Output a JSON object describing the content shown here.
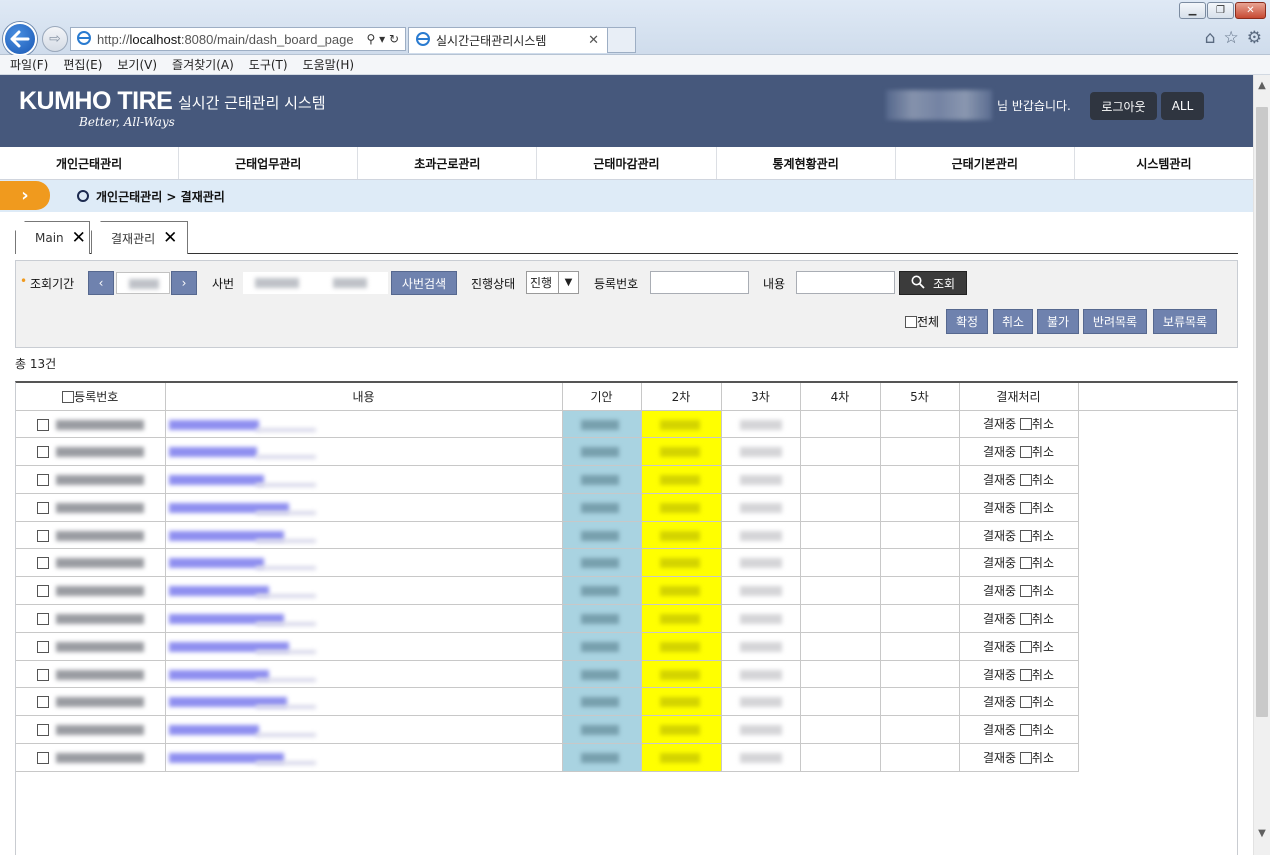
{
  "browser": {
    "url": "http://localhost:8080/main/dash_board_page",
    "url_host": "localhost",
    "url_pre": "http://",
    "url_post": ":8080/main/dash_board_page",
    "tab_title": "실시간근태관리시스템",
    "menu": [
      "파일(F)",
      "편집(E)",
      "보기(V)",
      "즐겨찾기(A)",
      "도구(T)",
      "도움말(H)"
    ]
  },
  "header": {
    "logo": "KUMHO TIRE",
    "tagline": "Better, All-Ways",
    "system_title": "실시간 근태관리 시스템",
    "greeting": "님 반갑습니다.",
    "logout": "로그아웃",
    "all": "ALL"
  },
  "gnb": [
    "개인근태관리",
    "근태업무관리",
    "초과근로관리",
    "근태마감관리",
    "통계현황관리",
    "근태기본관리",
    "시스템관리"
  ],
  "breadcrumb": "개인근태관리 > 결재관리",
  "page_tabs": [
    {
      "label": "Main"
    },
    {
      "label": "결재관리"
    }
  ],
  "search": {
    "period_label": "조회기간",
    "emp_label": "사번",
    "emp_search": "사번검색",
    "status_label": "진행상태",
    "status_value": "진행",
    "regno_label": "등록번호",
    "content_label": "내용",
    "search_btn": "조회",
    "all_label": "전체",
    "actions": [
      "확정",
      "취소",
      "불가",
      "반려목록",
      "보류목록"
    ]
  },
  "total": "총 13건",
  "table": {
    "headers": [
      "등록번호",
      "내용",
      "기안",
      "2차",
      "3차",
      "4차",
      "5차",
      "결재처리"
    ],
    "status_text": "결재중",
    "cancel_text": "취소",
    "row_count": 13
  },
  "colors": {
    "header_bg": "#46587c",
    "breadcrumb_bg": "#deebf7",
    "accent_orange": "#f09a1e",
    "button_blue": "#6f82ae",
    "col_gian": "#a9d3e1",
    "col_2nd": "#ffff00"
  }
}
